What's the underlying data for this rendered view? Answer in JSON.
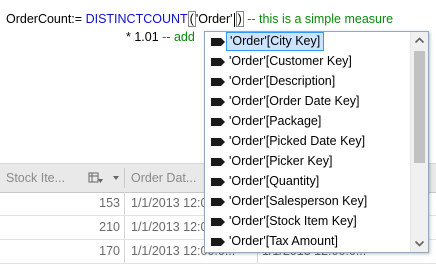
{
  "editor": {
    "line1": {
      "measure_name": "OrderCount:=",
      "function": "DISTINCTCOUNT",
      "open_paren": "(",
      "table_ref": "'Order'",
      "close_paren": ")",
      "comment": "-- this is a simple measure"
    },
    "line2": {
      "expression": "* 1.01",
      "comment": "-- add"
    }
  },
  "grid": {
    "headers": [
      "Stock Ite...",
      "Order Dat..."
    ],
    "rows": [
      {
        "stock": "153",
        "date": "1/1/2013 12:00:0..."
      },
      {
        "stock": "210",
        "date": "1/1/2013 12:00:0..."
      },
      {
        "stock": "170",
        "date": "1/1/2013 12:00:0...",
        "date2": "1/1/2013 12:00:0..."
      }
    ]
  },
  "autocomplete": {
    "items": [
      "'Order'[City Key]",
      "'Order'[Customer Key]",
      "'Order'[Description]",
      "'Order'[Order Date Key]",
      "'Order'[Package]",
      "'Order'[Picked Date Key]",
      "'Order'[Picker Key]",
      "'Order'[Quantity]",
      "'Order'[Salesperson Key]",
      "'Order'[Stock Item Key]",
      "'Order'[Tax Amount]"
    ],
    "selected_index": 0,
    "item_icon": "column-tag-icon",
    "colors": {
      "selection_bg": "#cce4ff",
      "selection_border": "#3399ff"
    }
  }
}
